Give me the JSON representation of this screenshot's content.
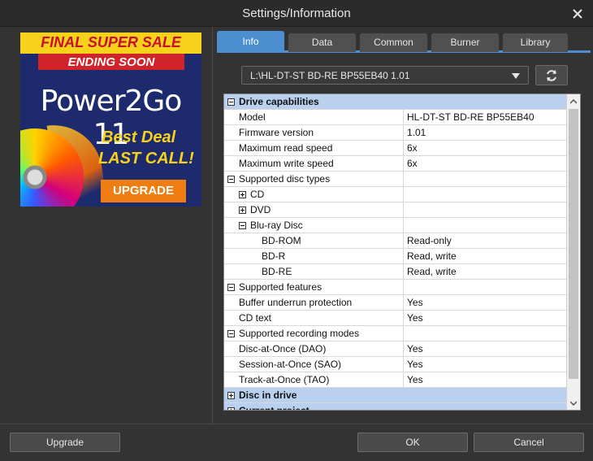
{
  "window": {
    "title": "Settings/Information"
  },
  "ad": {
    "banner": "FINAL SUPER SALE",
    "ribbon": "ENDING SOON",
    "product": "Power2Go 11",
    "deal_line1": "Best Deal",
    "deal_line2": "LAST CALL!",
    "button": "UPGRADE"
  },
  "tabs": [
    {
      "label": "Info",
      "active": true
    },
    {
      "label": "Data"
    },
    {
      "label": "Common"
    },
    {
      "label": "Burner"
    },
    {
      "label": "Library"
    }
  ],
  "drive": {
    "selected": "L:\\HL-DT-ST BD-RE BP55EB40 1.01"
  },
  "properties": [
    {
      "name": "Drive capabilities",
      "value": "",
      "level": 0,
      "type": "header",
      "expander": "minus"
    },
    {
      "name": "Model",
      "value": "HL-DT-ST BD-RE BP55EB40",
      "level": 1
    },
    {
      "name": "Firmware version",
      "value": "1.01",
      "level": 1
    },
    {
      "name": "Maximum read speed",
      "value": "6x",
      "level": 1
    },
    {
      "name": "Maximum write speed",
      "value": "6x",
      "level": 1
    },
    {
      "name": "Supported disc types",
      "value": "",
      "level": 0,
      "type": "group",
      "expander": "minus"
    },
    {
      "name": "CD",
      "value": "",
      "level": 1,
      "type": "group",
      "expander": "plus"
    },
    {
      "name": "DVD",
      "value": "",
      "level": 1,
      "type": "group",
      "expander": "plus"
    },
    {
      "name": "Blu-ray Disc",
      "value": "",
      "level": 1,
      "type": "group",
      "expander": "minus"
    },
    {
      "name": "BD-ROM",
      "value": "Read-only",
      "level": 2
    },
    {
      "name": "BD-R",
      "value": "Read, write",
      "level": 2
    },
    {
      "name": "BD-RE",
      "value": "Read, write",
      "level": 2
    },
    {
      "name": "Supported features",
      "value": "",
      "level": 0,
      "type": "group",
      "expander": "minus"
    },
    {
      "name": "Buffer underrun protection",
      "value": "Yes",
      "level": 1
    },
    {
      "name": "CD text",
      "value": "Yes",
      "level": 1
    },
    {
      "name": "Supported recording modes",
      "value": "",
      "level": 0,
      "type": "group",
      "expander": "minus"
    },
    {
      "name": "Disc-at-Once (DAO)",
      "value": "Yes",
      "level": 1
    },
    {
      "name": "Session-at-Once (SAO)",
      "value": "Yes",
      "level": 1
    },
    {
      "name": "Track-at-Once (TAO)",
      "value": "Yes",
      "level": 1
    },
    {
      "name": "Disc in drive",
      "value": "",
      "level": 0,
      "type": "header",
      "expander": "plus"
    },
    {
      "name": "Current project",
      "value": "",
      "level": 0,
      "type": "header",
      "expander": "plus"
    }
  ],
  "footer": {
    "upgrade": "Upgrade",
    "ok": "OK",
    "cancel": "Cancel"
  },
  "colors": {
    "accent": "#4b8fd1",
    "header_row": "#b9d1ee",
    "ad_orange": "#f07d12"
  }
}
